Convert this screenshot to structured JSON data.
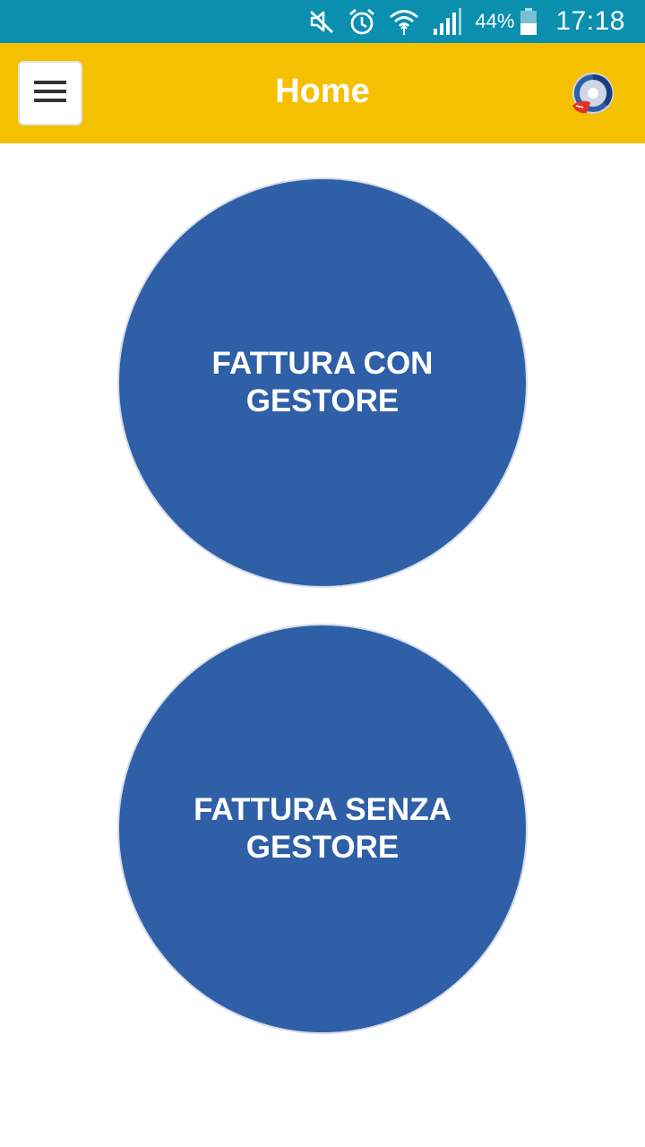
{
  "status_bar": {
    "battery_percent": "44%",
    "time": "17:18",
    "icons": [
      "mute-icon",
      "alarm-icon",
      "wifi-icon",
      "signal-icon",
      "battery-icon"
    ],
    "color": "#0a8fae"
  },
  "app_bar": {
    "title": "Home",
    "color": "#f5c000",
    "menu_icon": "hamburger-menu-icon",
    "logo_icon": "app-logo-icon"
  },
  "main": {
    "buttons": [
      {
        "label": "FATTURA CON GESTORE"
      },
      {
        "label": "FATTURA SENZA GESTORE"
      }
    ],
    "button_color": "#2f5fa7"
  }
}
